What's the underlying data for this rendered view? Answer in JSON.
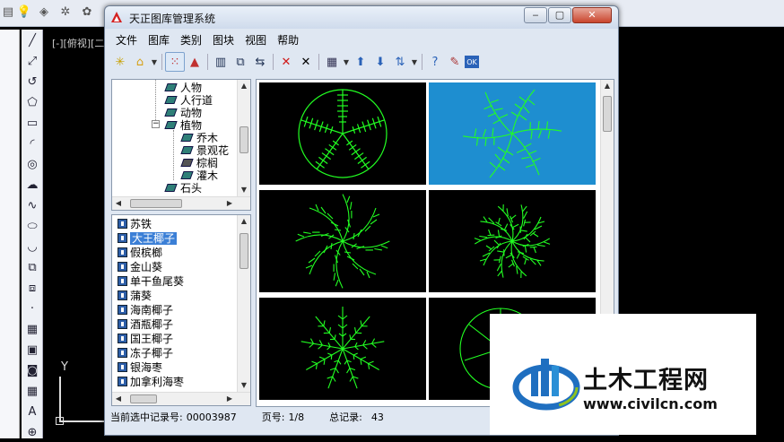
{
  "window": {
    "title": "天正图库管理系统",
    "min_label": "‒",
    "max_label": "▢",
    "close_label": "✕"
  },
  "menu": [
    "文件",
    "图库",
    "类别",
    "图块",
    "视图",
    "帮助"
  ],
  "tree": {
    "items": [
      "人物",
      "人行道",
      "动物",
      "植物",
      "乔木",
      "景观花",
      "棕榈",
      "灌木",
      "石头"
    ],
    "expander": "−"
  },
  "list": {
    "items": [
      "苏铁",
      "大王椰子",
      "假槟榔",
      "金山葵",
      "单干鱼尾葵",
      "蒲葵",
      "海南椰子",
      "酒瓶椰子",
      "国王椰子",
      "冻子椰子",
      "银海枣",
      "加拿利海枣"
    ],
    "selected_index": 1
  },
  "status": {
    "record_label": "当前选中记录号:",
    "record_value": "00003987",
    "page_label": "页号:",
    "page_value": "1/8",
    "total_label": "总记录:",
    "total_value": "43"
  },
  "cad": {
    "viewport_label": "[-][俯视][二",
    "ucs_y": "Y"
  },
  "watermark": {
    "title": "土木工程网",
    "url": "www.civilcn.com"
  },
  "colors": {
    "plant_green": "#22ff22",
    "selected_cell": "#1e8ed0",
    "list_selection": "#3b7fd6"
  }
}
